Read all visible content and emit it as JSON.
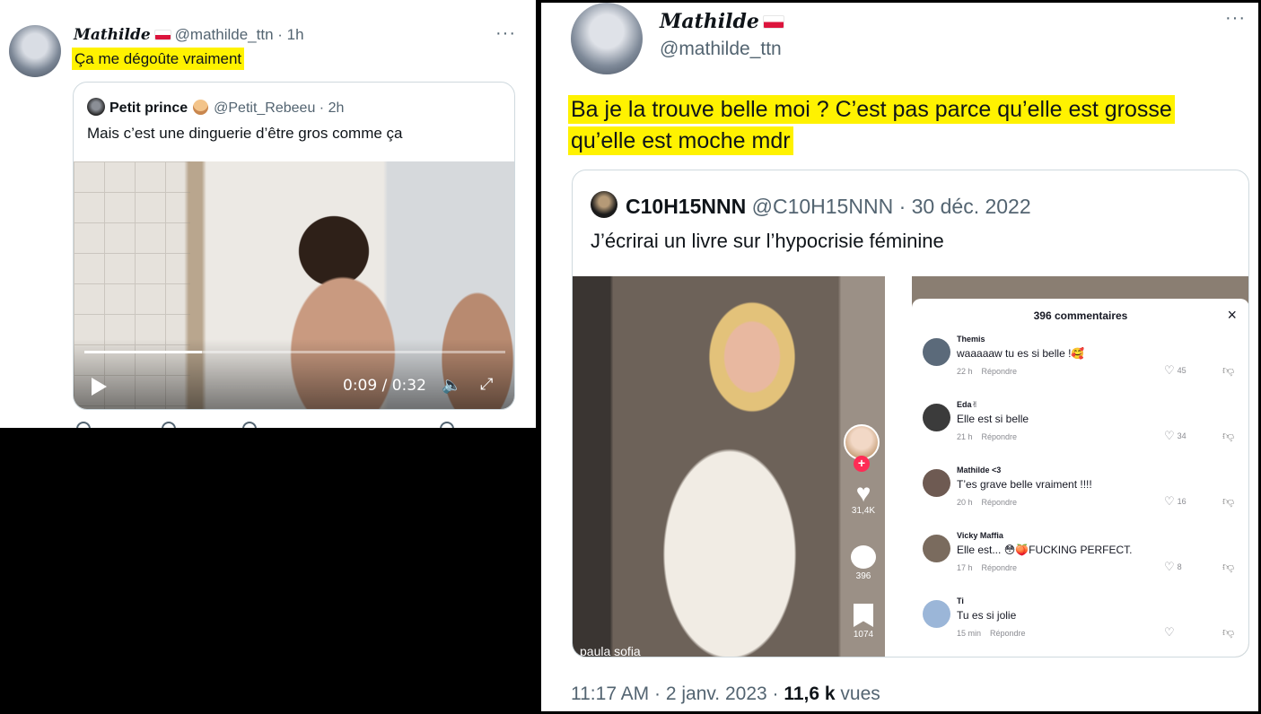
{
  "left_tweet": {
    "name": "Mathilde",
    "handle": "@mathilde_ttn",
    "separator": " · ",
    "time": "1h",
    "text": "Ça me dégoûte vraiment",
    "more": "···",
    "quote": {
      "name": "Petit prince",
      "handle": "@Petit_Rebeeu",
      "time": "2h",
      "text": "Mais c’est une dinguerie d’être gros comme ça",
      "video": {
        "time": "0:09 / 0:32",
        "progress": 0.28,
        "play_icon": "play-icon",
        "volume_icon": "volume-icon",
        "fullscreen_icon": "fullscreen-icon"
      }
    }
  },
  "right_tweet": {
    "name": "Mathilde",
    "handle": "@mathilde_ttn",
    "more": "···",
    "text_line1": "Ba je la trouve belle moi ? C’est pas parce qu’elle est grosse",
    "text_line2": "qu’elle est moche mdr",
    "quote": {
      "name": "C10H15NNN",
      "handle": "@C10H15NNN",
      "time": "30 déc. 2022",
      "text": "J’écrirai un livre sur l’hypocrisie féminine",
      "tiktok": {
        "likes": "31,4K",
        "comments": "396",
        "saves": "1074",
        "username": "paula sofia"
      },
      "comments_panel": {
        "title": "396 commentaires",
        "close": "×",
        "reply_label": "Répondre",
        "items": [
          {
            "user": "Themis",
            "text": "waaaaaw tu es si belle !🥰",
            "time": "22 h",
            "likes": "45",
            "avatar_color": "#5b6a7a"
          },
          {
            "user": "Eda✌",
            "text": "Elle est si belle",
            "time": "21 h",
            "likes": "34",
            "avatar_color": "#3b3b3b"
          },
          {
            "user": "Mathilde <3",
            "text": "T’es grave belle vraiment !!!!",
            "time": "20 h",
            "likes": "16",
            "avatar_color": "#6e5a52"
          },
          {
            "user": "Vicky Maffia",
            "text": "Elle est... 😳🍑FUCKING PERFECT.",
            "time": "17 h",
            "likes": "8",
            "avatar_color": "#7a6b5e"
          },
          {
            "user": "Ti",
            "text": "Tu es si jolie",
            "time": "15 min",
            "likes": "",
            "avatar_color": "#9bb6d8"
          }
        ]
      }
    },
    "footer": {
      "time_date": "11:17 AM · 2 janv. 2023 · ",
      "views": "11,6 k",
      "views_label": " vues"
    }
  },
  "colors": {
    "highlight": "#fff200",
    "text": "#0f1419",
    "muted": "#536471",
    "border": "#cfd9de",
    "tiktok_red": "#fe2c55"
  }
}
